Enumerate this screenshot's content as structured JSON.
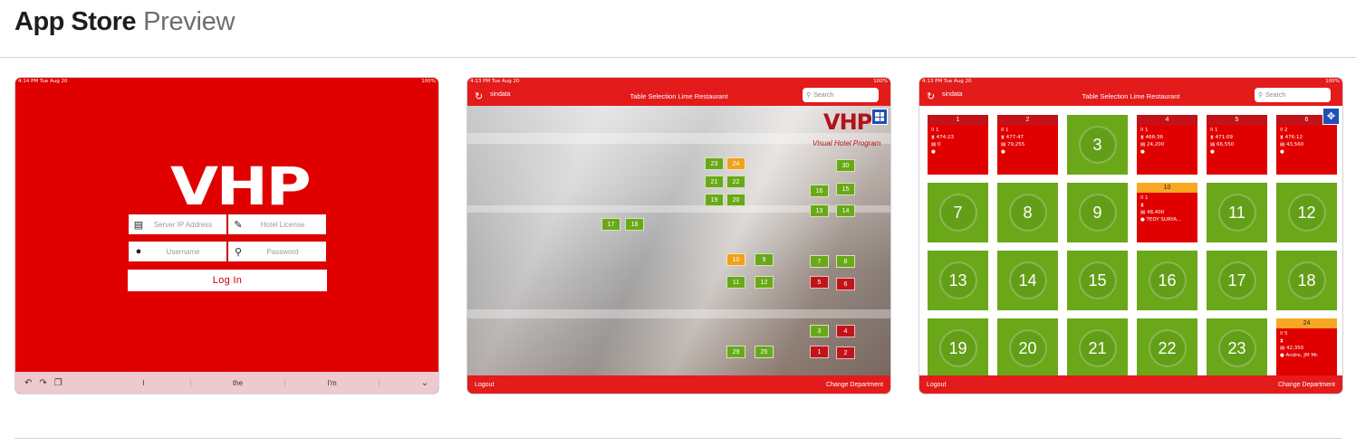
{
  "header": {
    "brand": "App Store",
    "subtitle": "Preview"
  },
  "colors": {
    "vhp_red": "#e10000",
    "table_green": "#6aa81a",
    "table_orange": "#f0a11c",
    "table_red": "#c0141b",
    "nav_red": "#e31b1b"
  },
  "shots": [
    {
      "status": {
        "time": "4:14 PM   Tue Aug 20",
        "battery": "100%"
      },
      "logo": "VHP",
      "fields": [
        {
          "icon": "server-icon",
          "placeholder": "Server IP Address"
        },
        {
          "icon": "license-icon",
          "placeholder": "Hotel License"
        },
        {
          "icon": "user-icon",
          "placeholder": "Username"
        },
        {
          "icon": "key-icon",
          "placeholder": "Password"
        }
      ],
      "login_label": "Log In",
      "keyboard": {
        "suggestions": [
          "I",
          "the",
          "I'm"
        ]
      }
    },
    {
      "status": {
        "time": "4:13 PM   Tue Aug 20",
        "battery": "100%"
      },
      "user": "sindata",
      "title": "Table Selection Lime Restaurant",
      "search_placeholder": "Search",
      "logo": "VHP",
      "logo_caption": "Visual Hotel Program",
      "tables": [
        {
          "n": "23",
          "s": "g"
        },
        {
          "n": "24",
          "s": "o"
        },
        {
          "n": "30",
          "s": "g"
        },
        {
          "n": "21",
          "s": "g"
        },
        {
          "n": "22",
          "s": "g"
        },
        {
          "n": "19",
          "s": "g"
        },
        {
          "n": "20",
          "s": "g"
        },
        {
          "n": "16",
          "s": "g"
        },
        {
          "n": "15",
          "s": "g"
        },
        {
          "n": "13",
          "s": "g"
        },
        {
          "n": "14",
          "s": "g"
        },
        {
          "n": "17",
          "s": "g"
        },
        {
          "n": "18",
          "s": "g"
        },
        {
          "n": "10",
          "s": "o"
        },
        {
          "n": "9",
          "s": "g"
        },
        {
          "n": "7",
          "s": "g"
        },
        {
          "n": "8",
          "s": "g"
        },
        {
          "n": "11",
          "s": "g"
        },
        {
          "n": "12",
          "s": "g"
        },
        {
          "n": "5",
          "s": "r"
        },
        {
          "n": "6",
          "s": "r"
        },
        {
          "n": "3",
          "s": "g"
        },
        {
          "n": "4",
          "s": "r"
        },
        {
          "n": "29",
          "s": "g"
        },
        {
          "n": "25",
          "s": "g"
        },
        {
          "n": "1",
          "s": "r"
        },
        {
          "n": "2",
          "s": "r"
        }
      ],
      "footer": {
        "left": "Logout",
        "right": "Change Department"
      }
    },
    {
      "status": {
        "time": "4:13 PM   Tue Aug 20",
        "battery": "100%"
      },
      "user": "sindata",
      "title": "Table Selection Lime Restaurant",
      "search_placeholder": "Search",
      "occupied": [
        {
          "n": "1",
          "guests": "1",
          "time": "474:23",
          "amount": "0",
          "name": ""
        },
        {
          "n": "2",
          "guests": "1",
          "time": "477:47",
          "amount": "79,255",
          "name": ""
        },
        {
          "n": "4",
          "guests": "1",
          "time": "466:36",
          "amount": "24,200",
          "name": ""
        },
        {
          "n": "5",
          "guests": "1",
          "time": "471:09",
          "amount": "66,550",
          "name": ""
        },
        {
          "n": "6",
          "guests": "2",
          "time": "476:12",
          "amount": "43,560",
          "name": ""
        },
        {
          "n": "10",
          "guests": "1",
          "time": "",
          "amount": "48,400",
          "name": "TEDY SURYA..."
        },
        {
          "n": "24",
          "guests": "5",
          "time": "",
          "amount": "42,350",
          "name": "Andre, JM Mr."
        }
      ],
      "free": [
        "3",
        "7",
        "8",
        "9",
        "11",
        "12",
        "13",
        "14",
        "15",
        "16",
        "17",
        "18",
        "19",
        "20",
        "21",
        "22",
        "23"
      ],
      "footer": {
        "left": "Logout",
        "right": "Change Department"
      }
    }
  ]
}
